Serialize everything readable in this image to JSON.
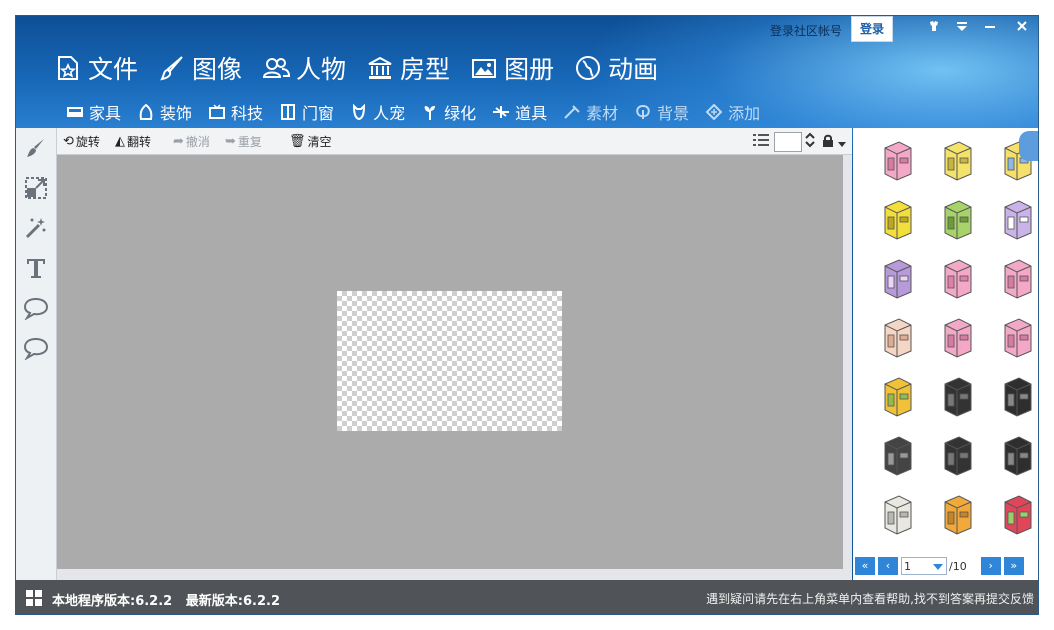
{
  "header": {
    "login_prompt": "登录社区帐号",
    "login_button": "登录"
  },
  "window_controls": [
    "skin-icon",
    "menu-icon",
    "minimize-icon",
    "close-icon"
  ],
  "main_nav": [
    {
      "label": "文件",
      "icon": "file-star-icon"
    },
    {
      "label": "图像",
      "icon": "brush-icon"
    },
    {
      "label": "人物",
      "icon": "people-icon"
    },
    {
      "label": "房型",
      "icon": "building-icon"
    },
    {
      "label": "图册",
      "icon": "album-icon"
    },
    {
      "label": "动画",
      "icon": "globe-icon"
    }
  ],
  "sub_nav": [
    {
      "label": "家具",
      "icon": "sofa-icon",
      "dim": false
    },
    {
      "label": "装饰",
      "icon": "decor-icon",
      "dim": false
    },
    {
      "label": "科技",
      "icon": "tv-icon",
      "dim": false
    },
    {
      "label": "门窗",
      "icon": "door-icon",
      "dim": false
    },
    {
      "label": "人宠",
      "icon": "pet-icon",
      "dim": false
    },
    {
      "label": "绿化",
      "icon": "plant-icon",
      "dim": false
    },
    {
      "label": "道具",
      "icon": "prop-icon",
      "dim": false
    },
    {
      "label": "素材",
      "icon": "material-icon",
      "dim": true
    },
    {
      "label": "背景",
      "icon": "background-icon",
      "dim": true
    },
    {
      "label": "添加",
      "icon": "add-icon",
      "dim": true
    }
  ],
  "left_tools": [
    "brush-tool-icon",
    "resize-tool-icon",
    "magic-wand-icon",
    "text-tool-icon",
    "speech-bubble-icon",
    "speech-bubble-alt-icon"
  ],
  "toolbar": {
    "rotate": "旋转",
    "flip": "翻转",
    "undo": "撤消",
    "redo": "重复",
    "clear": "清空"
  },
  "pager": {
    "current": "1",
    "total": "/10"
  },
  "status": {
    "version_text": "本地程序版本:6.2.2   最新版本:6.2.2",
    "help_text": "遇到疑问请先在右上角菜单内查看帮助,找不到答案再提交反馈"
  },
  "colors": {
    "header_dark": "#0e4f95",
    "header_light": "#2a7fd0",
    "canvas_bg": "#ababab",
    "status_bg": "#505458",
    "pager_blue": "#2f86d9"
  },
  "furniture_items": [
    "pink-wardrobe-icon",
    "yellow-wardrobe-icon",
    "yellow-mirror-icon",
    "yellow-drawer-icon",
    "green-frog-cabinet-icon",
    "purple-box-icon",
    "purple-cabinet-icon",
    "pink-vanity-icon",
    "pink-nightstand-icon",
    "tall-shelf-icon",
    "pink-stool-icon",
    "pink-tall-cabinet-icon",
    "yellow-bookshelf-icon",
    "black-dresser-icon",
    "black-drawer-icon",
    "black-tv-stand-icon",
    "black-cabinet-icon",
    "black-sideboard-icon",
    "white-cabinet-icon",
    "wood-dresser-icon",
    "pink-red-wardrobe-icon"
  ]
}
